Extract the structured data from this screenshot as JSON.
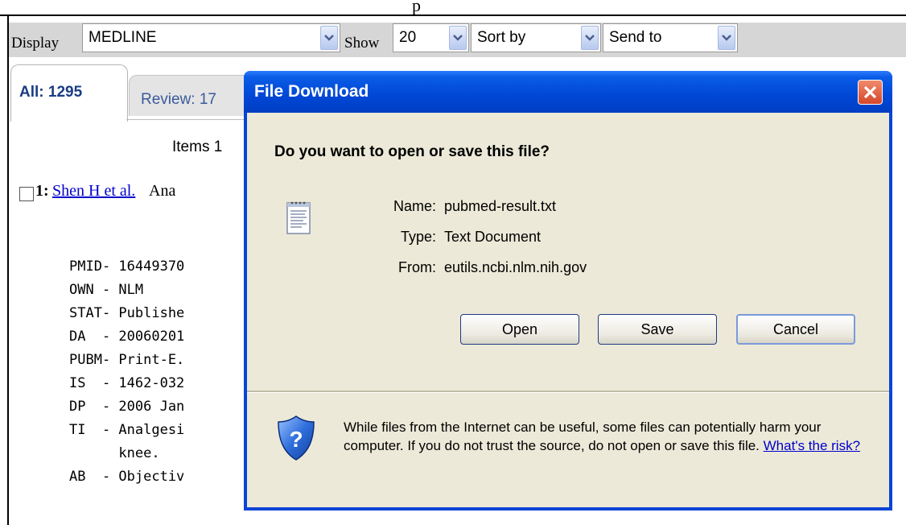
{
  "header_fragment": "p",
  "toolbar": {
    "display_label": "Display",
    "display_value": "MEDLINE",
    "show_label": "Show",
    "show_value": "20",
    "sort_value": "Sort by",
    "send_value": "Send to"
  },
  "tabs": [
    {
      "label": "All: 1295"
    },
    {
      "label": "Review: 17"
    }
  ],
  "items_text": "Items 1",
  "result": {
    "number": "1:",
    "authors": "Shen H et al.",
    "title_fragment": "Ana"
  },
  "medline_lines": [
    "PMID- 16449370",
    "OWN - NLM",
    "STAT- Publishe",
    "DA  - 20060201",
    "PUBM- Print-E.",
    "IS  - 1462-032",
    "DP  - 2006 Jan",
    "TI  - Analgesi",
    "      knee.",
    "AB  - Objectiv"
  ],
  "dialog": {
    "title": "File Download",
    "question": "Do you want to open or save this file?",
    "name_label": "Name:",
    "name_value": "pubmed-result.txt",
    "type_label": "Type:",
    "type_value": "Text Document",
    "from_label": "From:",
    "from_value": "eutils.ncbi.nlm.nih.gov",
    "open_button": "Open",
    "save_button": "Save",
    "cancel_button": "Cancel",
    "warning_text": "While files from the Internet can be useful, some files can potentially harm your computer. If you do not trust the source, do not open or save this file.",
    "risk_link": "What's the risk?"
  },
  "colors": {
    "titlebar": "#0047d6",
    "dialog_body": "#ece9d8",
    "toolbar": "#d6d6d6",
    "link": "#0000cc"
  }
}
